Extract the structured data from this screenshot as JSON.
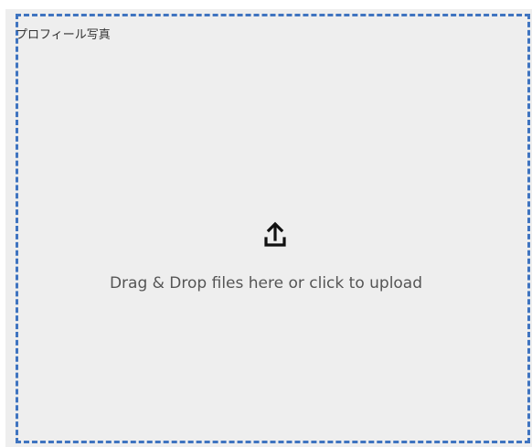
{
  "upload": {
    "label": "プロフィール写真",
    "hint": "Drag & Drop files here or click to upload",
    "icon": "upload-icon"
  },
  "colors": {
    "panel_background": "#eeeeee",
    "dashed_border": "#3f74c0",
    "text": "#555555"
  }
}
